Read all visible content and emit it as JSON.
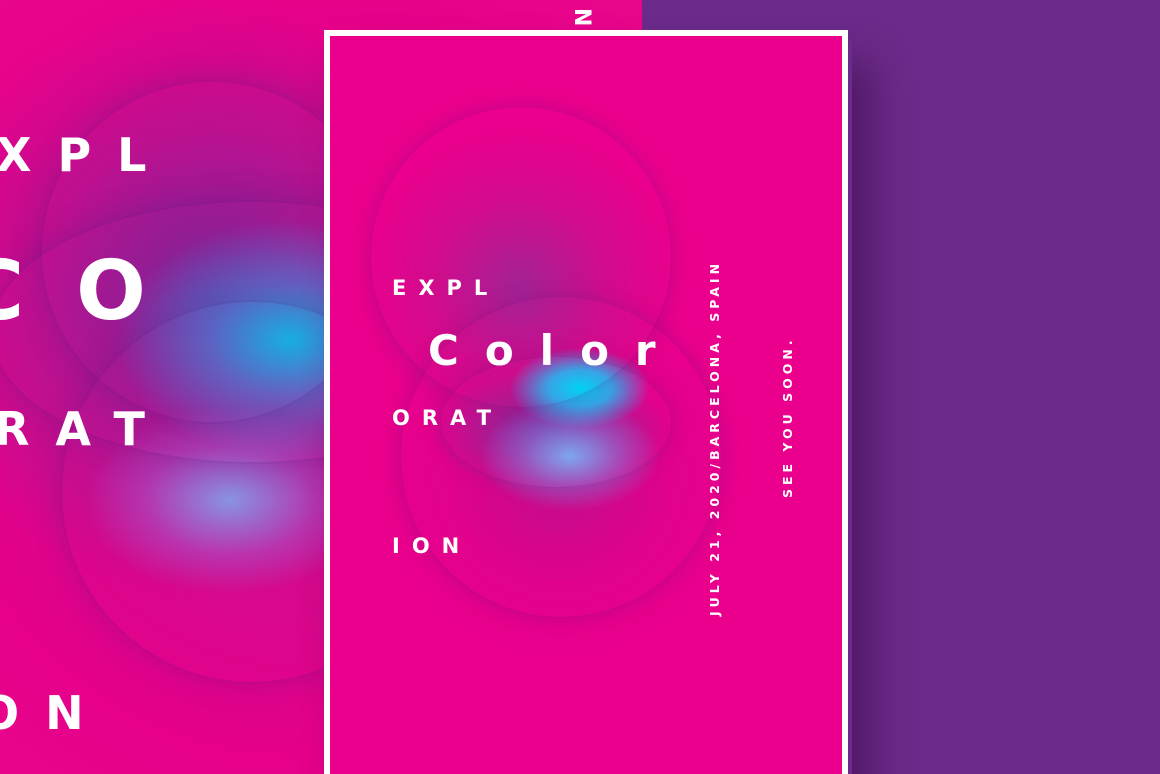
{
  "colors": {
    "magenta": "#ea008c",
    "purple": "#6c2a8a",
    "cyan": "#00c8f0",
    "frame": "#ffffff",
    "text": "#ffffff"
  },
  "background_poster": {
    "edge_text": "N",
    "line1": "XPL",
    "line2": "CO",
    "line3": "RAT",
    "line4": "ON"
  },
  "poster": {
    "line1": "EXPL",
    "line2": "Color",
    "line3": "ORAT",
    "line4": "ION",
    "date_location": "JULY 21, 2020/BARCELONA, SPAIN",
    "tagline": "SEE YOU SOON."
  }
}
